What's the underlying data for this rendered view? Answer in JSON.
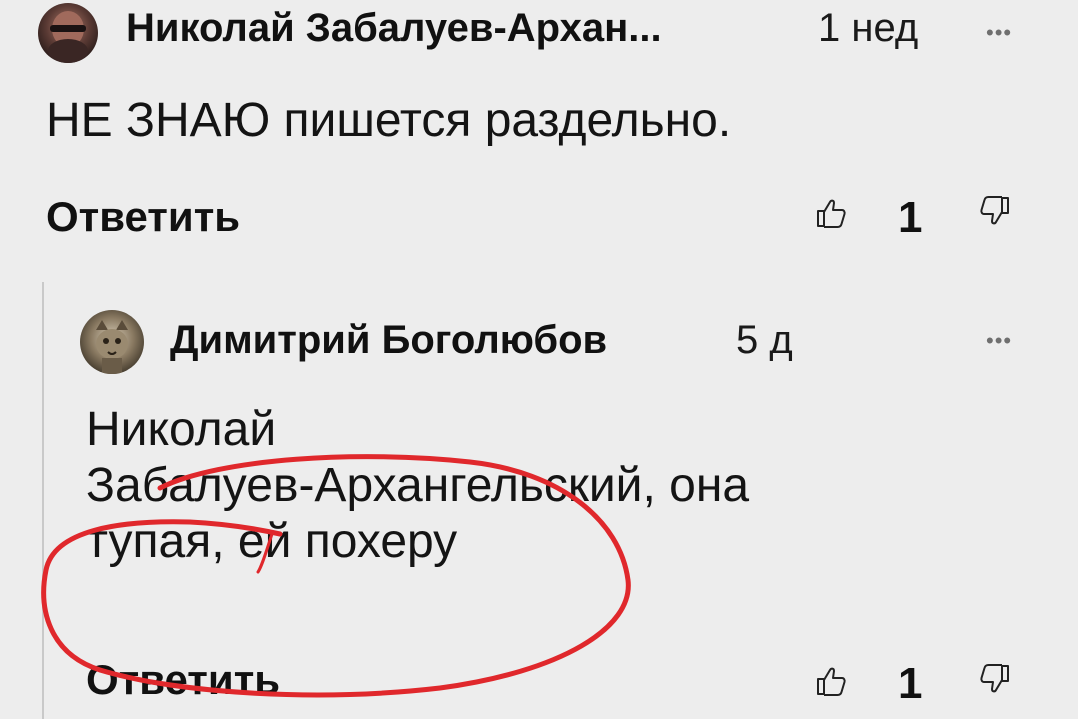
{
  "comments": [
    {
      "author": "Николай Забалуев-Архан...",
      "time": "1 нед",
      "text": "НЕ ЗНАЮ пишется раздельно.",
      "reply_label": "Ответить",
      "likes": "1",
      "more_icon": "more-options-icon",
      "like_icon": "thumbs-up-icon",
      "dislike_icon": "thumbs-down-icon"
    }
  ],
  "reply": {
    "author": "Димитрий Боголюбов",
    "time": "5 д",
    "text_line1": "Николай",
    "text_line2": "Забалуев-Архангельский, она",
    "text_line3": "тупая, ей похеру",
    "reply_label": "Ответить",
    "likes": "1",
    "more_icon": "more-options-icon",
    "like_icon": "thumbs-up-icon",
    "dislike_icon": "thumbs-down-icon"
  },
  "colors": {
    "background": "#ededed",
    "annotation": "#e0282c",
    "thread_line": "#c9c9c9"
  }
}
